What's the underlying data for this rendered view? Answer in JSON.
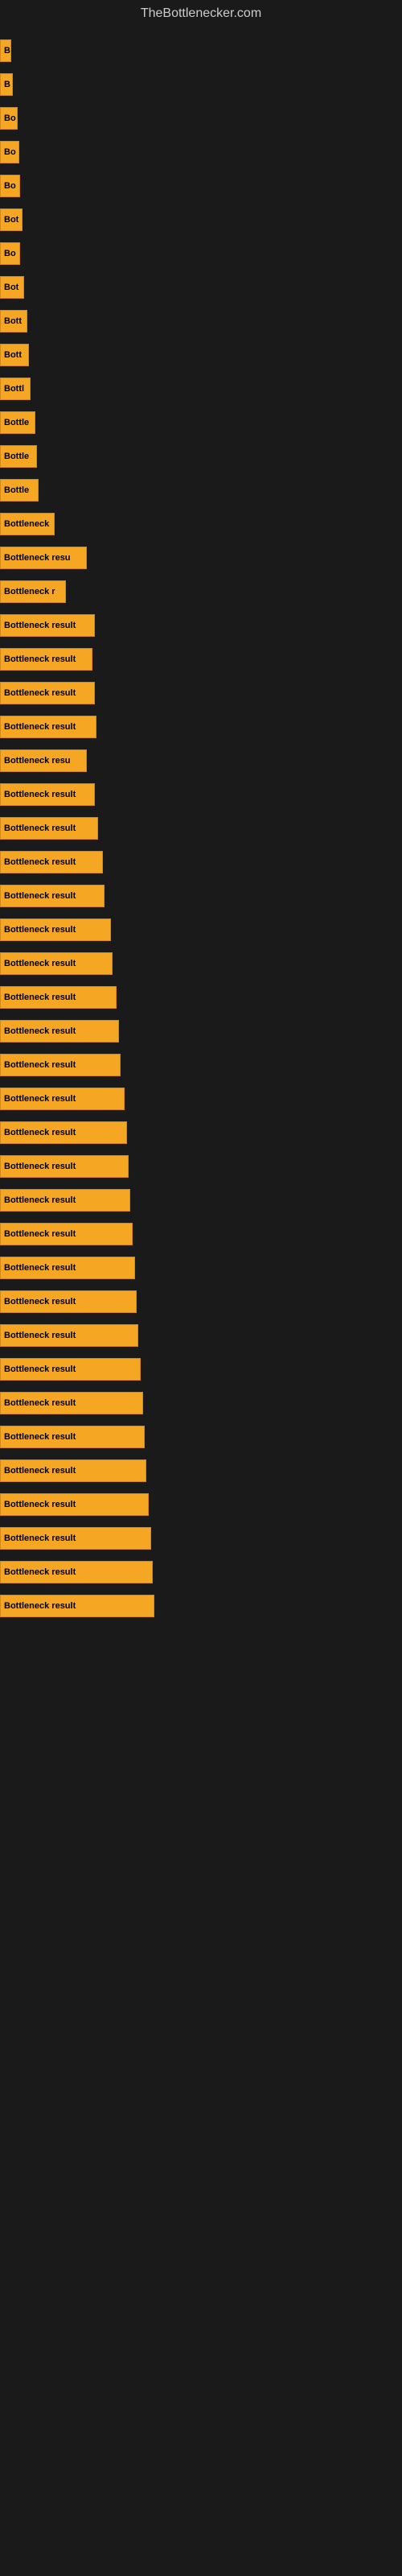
{
  "site": {
    "title": "TheBottlenecker.com"
  },
  "bars": [
    {
      "label": "B",
      "width": 14
    },
    {
      "label": "B",
      "width": 16
    },
    {
      "label": "Bo",
      "width": 22
    },
    {
      "label": "Bo",
      "width": 24
    },
    {
      "label": "Bo",
      "width": 25
    },
    {
      "label": "Bot",
      "width": 28
    },
    {
      "label": "Bo",
      "width": 25
    },
    {
      "label": "Bot",
      "width": 30
    },
    {
      "label": "Bott",
      "width": 34
    },
    {
      "label": "Bott",
      "width": 36
    },
    {
      "label": "Bottl",
      "width": 38
    },
    {
      "label": "Bottle",
      "width": 44
    },
    {
      "label": "Bottle",
      "width": 46
    },
    {
      "label": "Bottle",
      "width": 48
    },
    {
      "label": "Bottleneck",
      "width": 68
    },
    {
      "label": "Bottleneck resu",
      "width": 108
    },
    {
      "label": "Bottleneck r",
      "width": 82
    },
    {
      "label": "Bottleneck result",
      "width": 118
    },
    {
      "label": "Bottleneck result",
      "width": 115
    },
    {
      "label": "Bottleneck result",
      "width": 118
    },
    {
      "label": "Bottleneck result",
      "width": 120
    },
    {
      "label": "Bottleneck resu",
      "width": 108
    },
    {
      "label": "Bottleneck result",
      "width": 118
    },
    {
      "label": "Bottleneck result",
      "width": 122
    },
    {
      "label": "Bottleneck result",
      "width": 128
    },
    {
      "label": "Bottleneck result",
      "width": 130
    },
    {
      "label": "Bottleneck result",
      "width": 138
    },
    {
      "label": "Bottleneck result",
      "width": 140
    },
    {
      "label": "Bottleneck result",
      "width": 145
    },
    {
      "label": "Bottleneck result",
      "width": 148
    },
    {
      "label": "Bottleneck result",
      "width": 150
    },
    {
      "label": "Bottleneck result",
      "width": 155
    },
    {
      "label": "Bottleneck result",
      "width": 158
    },
    {
      "label": "Bottleneck result",
      "width": 160
    },
    {
      "label": "Bottleneck result",
      "width": 162
    },
    {
      "label": "Bottleneck result",
      "width": 165
    },
    {
      "label": "Bottleneck result",
      "width": 168
    },
    {
      "label": "Bottleneck result",
      "width": 170
    },
    {
      "label": "Bottleneck result",
      "width": 172
    },
    {
      "label": "Bottleneck result",
      "width": 175
    },
    {
      "label": "Bottleneck result",
      "width": 178
    },
    {
      "label": "Bottleneck result",
      "width": 180
    },
    {
      "label": "Bottleneck result",
      "width": 182
    },
    {
      "label": "Bottleneck result",
      "width": 185
    },
    {
      "label": "Bottleneck result",
      "width": 188
    },
    {
      "label": "Bottleneck result",
      "width": 190
    },
    {
      "label": "Bottleneck result",
      "width": 192
    }
  ]
}
